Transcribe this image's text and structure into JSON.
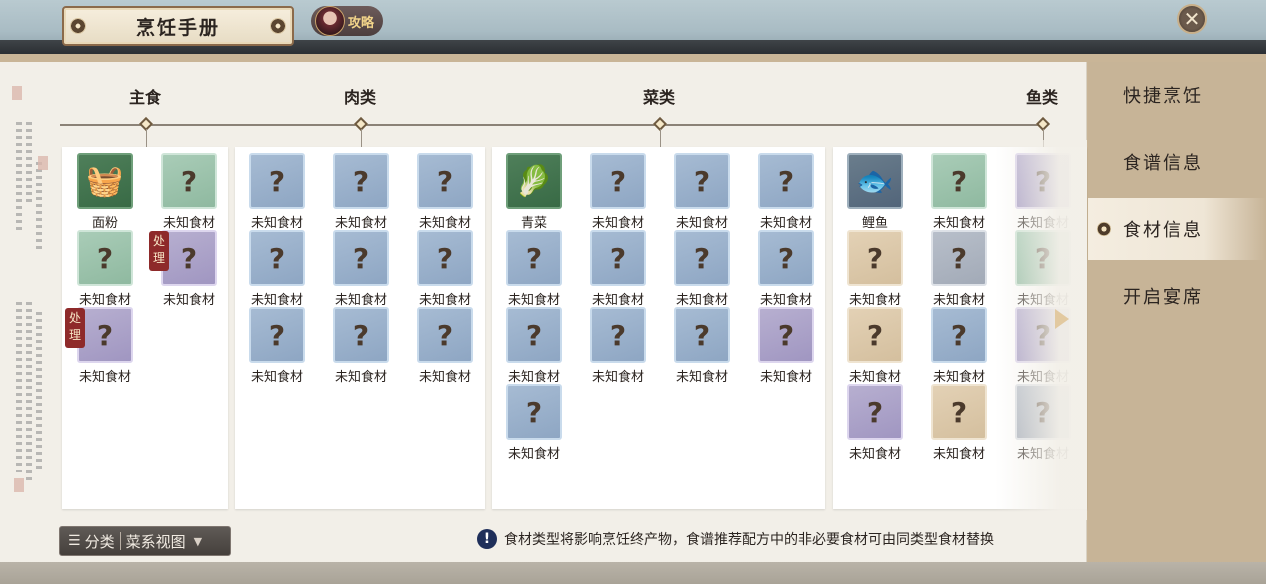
{
  "header": {
    "title": "烹饪手册",
    "guide_label": "攻略",
    "close_glyph": "✕"
  },
  "categories": [
    {
      "label": "主食"
    },
    {
      "label": "肉类"
    },
    {
      "label": "菜类"
    },
    {
      "label": "鱼类"
    }
  ],
  "tag_process": "处理",
  "unknown_glyph": "?",
  "columns": {
    "staple": [
      {
        "name": "面粉",
        "color": "known",
        "icon": "flour-sack-icon",
        "glyph": "🧺"
      },
      {
        "name": "未知食材",
        "color": "green"
      },
      {
        "name": "未知食材",
        "color": "green"
      },
      {
        "name": "未知食材",
        "color": "purple",
        "tag": true
      },
      {
        "name": "未知食材",
        "color": "purple",
        "tag": true
      }
    ],
    "meat": [
      {
        "name": "未知食材",
        "color": "blue"
      },
      {
        "name": "未知食材",
        "color": "blue"
      },
      {
        "name": "未知食材",
        "color": "blue"
      },
      {
        "name": "未知食材",
        "color": "blue"
      },
      {
        "name": "未知食材",
        "color": "blue"
      },
      {
        "name": "未知食材",
        "color": "blue"
      },
      {
        "name": "未知食材",
        "color": "blue"
      },
      {
        "name": "未知食材",
        "color": "blue"
      },
      {
        "name": "未知食材",
        "color": "blue"
      }
    ],
    "veg": [
      {
        "name": "青菜",
        "color": "known",
        "icon": "bok-choy-icon",
        "glyph": "🥬"
      },
      {
        "name": "未知食材",
        "color": "blue"
      },
      {
        "name": "未知食材",
        "color": "blue"
      },
      {
        "name": "未知食材",
        "color": "blue"
      },
      {
        "name": "未知食材",
        "color": "blue"
      },
      {
        "name": "未知食材",
        "color": "blue"
      },
      {
        "name": "未知食材",
        "color": "blue"
      },
      {
        "name": "未知食材",
        "color": "blue"
      },
      {
        "name": "未知食材",
        "color": "blue"
      },
      {
        "name": "未知食材",
        "color": "blue"
      },
      {
        "name": "未知食材",
        "color": "blue"
      },
      {
        "name": "未知食材",
        "color": "purple"
      },
      {
        "name": "未知食材",
        "color": "blue"
      }
    ],
    "fish": [
      {
        "name": "鲤鱼",
        "color": "known-fish",
        "icon": "carp-fish-icon",
        "glyph": "🐟"
      },
      {
        "name": "未知食材",
        "color": "green"
      },
      {
        "name": "未知食材",
        "color": "purple"
      },
      {
        "name": "未知食材",
        "color": "tan"
      },
      {
        "name": "未知食材",
        "color": "grey"
      },
      {
        "name": "未知食材",
        "color": "green"
      },
      {
        "name": "未知食材",
        "color": "tan"
      },
      {
        "name": "未知食材",
        "color": "blue"
      },
      {
        "name": "未知食材",
        "color": "purple"
      },
      {
        "name": "未知食材",
        "color": "purple"
      },
      {
        "name": "未知食材",
        "color": "tan"
      },
      {
        "name": "未知食材",
        "color": "grey"
      }
    ]
  },
  "bottom": {
    "classify_label": "分类",
    "view_label": "菜系视图",
    "hint_text": "食材类型将影响烹饪终产物，食谱推荐配方中的非必要食材可由同类型食材替换"
  },
  "menu": [
    {
      "label": "快捷烹饪",
      "active": false
    },
    {
      "label": "食谱信息",
      "active": false
    },
    {
      "label": "食材信息",
      "active": true
    },
    {
      "label": "开启宴席",
      "active": false
    }
  ],
  "colors": {
    "accent_red": "#8e2a2a",
    "panel_bg": "#f2efe8",
    "menu_bg": "#c7b497"
  }
}
